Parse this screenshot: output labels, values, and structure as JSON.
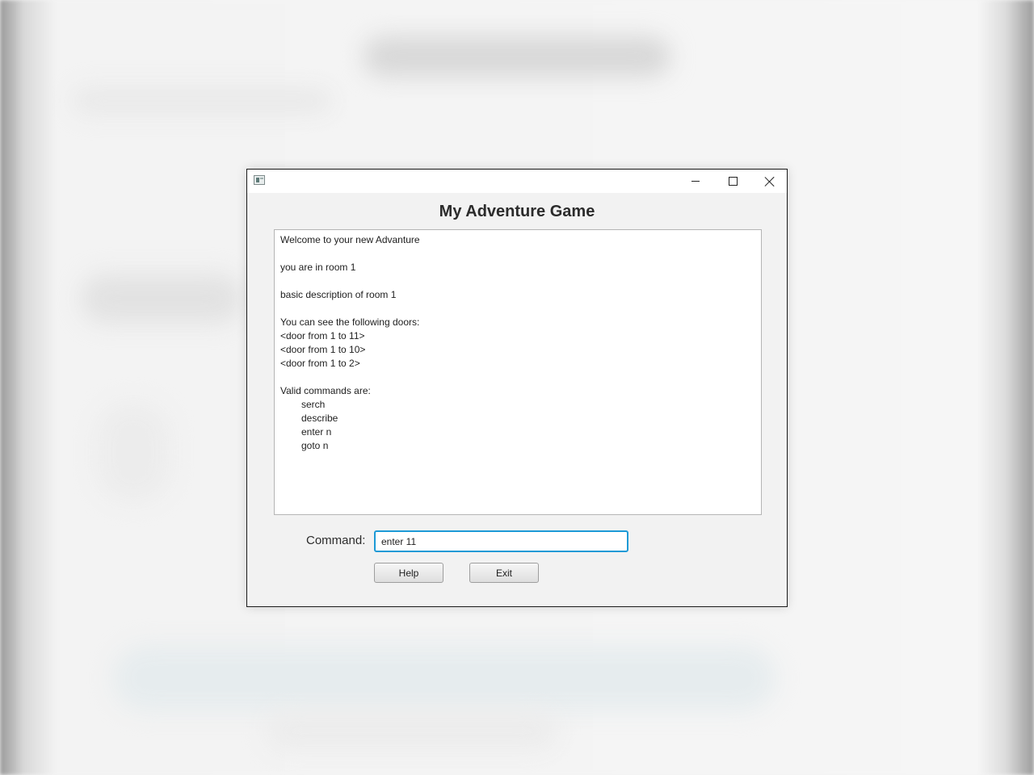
{
  "window": {
    "title": "",
    "controls": {
      "minimize_icon": "minimize-icon",
      "maximize_icon": "maximize-icon",
      "close_icon": "close-icon"
    }
  },
  "game": {
    "title": "My Adventure Game",
    "output_lines": [
      {
        "text": "Welcome to your new Advanture",
        "indent": false
      },
      {
        "text": "",
        "indent": false
      },
      {
        "text": "you are in room 1",
        "indent": false
      },
      {
        "text": "",
        "indent": false
      },
      {
        "text": "basic description of room 1",
        "indent": false
      },
      {
        "text": "",
        "indent": false
      },
      {
        "text": "You can see the following doors:",
        "indent": false
      },
      {
        "text": "<door from 1 to 11>",
        "indent": false
      },
      {
        "text": "<door from 1 to 10>",
        "indent": false
      },
      {
        "text": "<door from 1 to 2>",
        "indent": false
      },
      {
        "text": "",
        "indent": false
      },
      {
        "text": "Valid commands are:",
        "indent": false
      },
      {
        "text": "serch",
        "indent": true
      },
      {
        "text": "describe",
        "indent": true
      },
      {
        "text": "enter n",
        "indent": true
      },
      {
        "text": "goto n",
        "indent": true
      }
    ],
    "command_label": "Command:",
    "command_value": "enter 11",
    "help_label": "Help",
    "exit_label": "Exit",
    "accent_color": "#1d9ad6"
  }
}
